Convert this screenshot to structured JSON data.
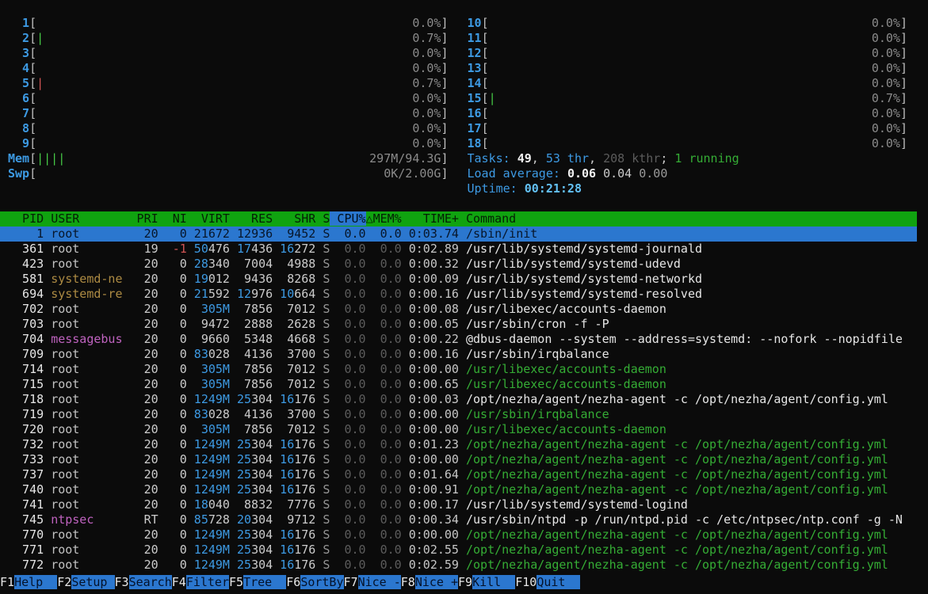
{
  "meters": {
    "left": [
      {
        "name": "cpu-meter-1",
        "label": "  1",
        "bars": 0,
        "bar_color": "green",
        "value": "0.0%"
      },
      {
        "name": "cpu-meter-2",
        "label": "  2",
        "bars": 1,
        "bar_color": "green",
        "value": "0.7%"
      },
      {
        "name": "cpu-meter-3",
        "label": "  3",
        "bars": 0,
        "bar_color": "green",
        "value": "0.0%"
      },
      {
        "name": "cpu-meter-4",
        "label": "  4",
        "bars": 0,
        "bar_color": "green",
        "value": "0.0%"
      },
      {
        "name": "cpu-meter-5",
        "label": "  5",
        "bars": 1,
        "bar_color": "red",
        "value": "0.7%"
      },
      {
        "name": "cpu-meter-6",
        "label": "  6",
        "bars": 0,
        "bar_color": "green",
        "value": "0.0%"
      },
      {
        "name": "cpu-meter-7",
        "label": "  7",
        "bars": 0,
        "bar_color": "green",
        "value": "0.0%"
      },
      {
        "name": "cpu-meter-8",
        "label": "  8",
        "bars": 0,
        "bar_color": "green",
        "value": "0.0%"
      },
      {
        "name": "cpu-meter-9",
        "label": "  9",
        "bars": 0,
        "bar_color": "green",
        "value": "0.0%"
      },
      {
        "name": "mem-meter",
        "label": "Mem",
        "bars": 4,
        "bar_color": "green",
        "value": "297M/94.3G"
      },
      {
        "name": "swp-meter",
        "label": "Swp",
        "bars": 0,
        "bar_color": "green",
        "value": "0K/2.00G"
      }
    ],
    "right": [
      {
        "name": "cpu-meter-10",
        "label": "10",
        "bars": 0,
        "bar_color": "green",
        "value": "0.0%"
      },
      {
        "name": "cpu-meter-11",
        "label": "11",
        "bars": 0,
        "bar_color": "green",
        "value": "0.0%"
      },
      {
        "name": "cpu-meter-12",
        "label": "12",
        "bars": 0,
        "bar_color": "green",
        "value": "0.0%"
      },
      {
        "name": "cpu-meter-13",
        "label": "13",
        "bars": 0,
        "bar_color": "green",
        "value": "0.0%"
      },
      {
        "name": "cpu-meter-14",
        "label": "14",
        "bars": 0,
        "bar_color": "green",
        "value": "0.0%"
      },
      {
        "name": "cpu-meter-15",
        "label": "15",
        "bars": 1,
        "bar_color": "green",
        "value": "0.7%"
      },
      {
        "name": "cpu-meter-16",
        "label": "16",
        "bars": 0,
        "bar_color": "green",
        "value": "0.0%"
      },
      {
        "name": "cpu-meter-17",
        "label": "17",
        "bars": 0,
        "bar_color": "green",
        "value": "0.0%"
      },
      {
        "name": "cpu-meter-18",
        "label": "18",
        "bars": 0,
        "bar_color": "green",
        "value": "0.0%"
      },
      {
        "name": "tasks-summary",
        "segments": [
          [
            "Tasks: ",
            "cyan"
          ],
          [
            "49",
            "bold"
          ],
          [
            ", ",
            "norm"
          ],
          [
            "53 thr",
            "cyan"
          ],
          [
            ", ",
            "norm"
          ],
          [
            "208 kthr",
            "shadow"
          ],
          [
            "; ",
            "norm"
          ],
          [
            "1 running",
            "green"
          ]
        ]
      },
      {
        "name": "load-average",
        "segments": [
          [
            "Load average: ",
            "cyan"
          ],
          [
            "0.06 ",
            "bold"
          ],
          [
            "0.04 ",
            "norm"
          ],
          [
            "0.00",
            "gray"
          ]
        ]
      },
      {
        "name": "uptime",
        "segments": [
          [
            "Uptime: ",
            "cyan"
          ],
          [
            "00:21:28",
            "bcyan"
          ]
        ]
      }
    ]
  },
  "table": {
    "headers": {
      "pid": "PID",
      "user": "USER",
      "pri": "PRI",
      "ni": "NI",
      "virt": "VIRT",
      "res": "RES",
      "shr": "SHR",
      "s": "S",
      "cpu": "CPU%",
      "mem": "MEM%",
      "time": "TIME+",
      "cmd": "Command"
    },
    "sort_column": "cpu",
    "sort_arrow": "△",
    "rows": [
      {
        "pid": "1",
        "user": "root",
        "pri": "20",
        "ni": "0",
        "virt": "21672",
        "res": "12936",
        "shr": "9452",
        "s": "S",
        "cpu": "0.0",
        "mem": "0.0",
        "time": "0:03.74",
        "cmd": "/sbin/init",
        "selected": true
      },
      {
        "pid": "361",
        "user": "root",
        "pri": "19",
        "ni": "-1",
        "virt": "50476",
        "res": "17436",
        "shr": "16272",
        "s": "S",
        "cpu": "0.0",
        "mem": "0.0",
        "time": "0:02.89",
        "cmd": "/usr/lib/systemd/systemd-journald"
      },
      {
        "pid": "423",
        "user": "root",
        "pri": "20",
        "ni": "0",
        "virt": "28340",
        "res": "7004",
        "shr": "4988",
        "s": "S",
        "cpu": "0.0",
        "mem": "0.0",
        "time": "0:00.32",
        "cmd": "/usr/lib/systemd/systemd-udevd"
      },
      {
        "pid": "581",
        "user": "systemd-ne",
        "user_color": "yellow",
        "pri": "20",
        "ni": "0",
        "virt": "19012",
        "res": "9436",
        "shr": "8268",
        "s": "S",
        "cpu": "0.0",
        "mem": "0.0",
        "time": "0:00.09",
        "cmd": "/usr/lib/systemd/systemd-networkd"
      },
      {
        "pid": "694",
        "user": "systemd-re",
        "user_color": "yellow",
        "pri": "20",
        "ni": "0",
        "virt": "21592",
        "res": "12976",
        "shr": "10664",
        "s": "S",
        "cpu": "0.0",
        "mem": "0.0",
        "time": "0:00.16",
        "cmd": "/usr/lib/systemd/systemd-resolved"
      },
      {
        "pid": "702",
        "user": "root",
        "pri": "20",
        "ni": "0",
        "virt": "305M",
        "res": "7856",
        "shr": "7012",
        "s": "S",
        "cpu": "0.0",
        "mem": "0.0",
        "time": "0:00.08",
        "cmd": "/usr/libexec/accounts-daemon"
      },
      {
        "pid": "703",
        "user": "root",
        "pri": "20",
        "ni": "0",
        "virt": "9472",
        "res": "2888",
        "shr": "2628",
        "s": "S",
        "cpu": "0.0",
        "mem": "0.0",
        "time": "0:00.05",
        "cmd": "/usr/sbin/cron -f -P"
      },
      {
        "pid": "704",
        "user": "messagebus",
        "user_color": "magenta",
        "pri": "20",
        "ni": "0",
        "virt": "9660",
        "res": "5348",
        "shr": "4668",
        "s": "S",
        "cpu": "0.0",
        "mem": "0.0",
        "time": "0:00.22",
        "cmd": "@dbus-daemon --system --address=systemd: --nofork --nopidfile"
      },
      {
        "pid": "709",
        "user": "root",
        "pri": "20",
        "ni": "0",
        "virt": "83028",
        "res": "4136",
        "shr": "3700",
        "s": "S",
        "cpu": "0.0",
        "mem": "0.0",
        "time": "0:00.16",
        "cmd": "/usr/sbin/irqbalance"
      },
      {
        "pid": "714",
        "user": "root",
        "pri": "20",
        "ni": "0",
        "virt": "305M",
        "res": "7856",
        "shr": "7012",
        "s": "S",
        "cpu": "0.0",
        "mem": "0.0",
        "time": "0:00.00",
        "cmd": "/usr/libexec/accounts-daemon",
        "thread": true
      },
      {
        "pid": "715",
        "user": "root",
        "pri": "20",
        "ni": "0",
        "virt": "305M",
        "res": "7856",
        "shr": "7012",
        "s": "S",
        "cpu": "0.0",
        "mem": "0.0",
        "time": "0:00.65",
        "cmd": "/usr/libexec/accounts-daemon",
        "thread": true
      },
      {
        "pid": "718",
        "user": "root",
        "pri": "20",
        "ni": "0",
        "virt": "1249M",
        "res": "25304",
        "shr": "16176",
        "s": "S",
        "cpu": "0.0",
        "mem": "0.0",
        "time": "0:00.03",
        "cmd": "/opt/nezha/agent/nezha-agent -c /opt/nezha/agent/config.yml"
      },
      {
        "pid": "719",
        "user": "root",
        "pri": "20",
        "ni": "0",
        "virt": "83028",
        "res": "4136",
        "shr": "3700",
        "s": "S",
        "cpu": "0.0",
        "mem": "0.0",
        "time": "0:00.00",
        "cmd": "/usr/sbin/irqbalance",
        "thread": true
      },
      {
        "pid": "720",
        "user": "root",
        "pri": "20",
        "ni": "0",
        "virt": "305M",
        "res": "7856",
        "shr": "7012",
        "s": "S",
        "cpu": "0.0",
        "mem": "0.0",
        "time": "0:00.00",
        "cmd": "/usr/libexec/accounts-daemon",
        "thread": true
      },
      {
        "pid": "732",
        "user": "root",
        "pri": "20",
        "ni": "0",
        "virt": "1249M",
        "res": "25304",
        "shr": "16176",
        "s": "S",
        "cpu": "0.0",
        "mem": "0.0",
        "time": "0:01.23",
        "cmd": "/opt/nezha/agent/nezha-agent -c /opt/nezha/agent/config.yml",
        "thread": true
      },
      {
        "pid": "733",
        "user": "root",
        "pri": "20",
        "ni": "0",
        "virt": "1249M",
        "res": "25304",
        "shr": "16176",
        "s": "S",
        "cpu": "0.0",
        "mem": "0.0",
        "time": "0:00.00",
        "cmd": "/opt/nezha/agent/nezha-agent -c /opt/nezha/agent/config.yml",
        "thread": true
      },
      {
        "pid": "737",
        "user": "root",
        "pri": "20",
        "ni": "0",
        "virt": "1249M",
        "res": "25304",
        "shr": "16176",
        "s": "S",
        "cpu": "0.0",
        "mem": "0.0",
        "time": "0:01.64",
        "cmd": "/opt/nezha/agent/nezha-agent -c /opt/nezha/agent/config.yml",
        "thread": true
      },
      {
        "pid": "740",
        "user": "root",
        "pri": "20",
        "ni": "0",
        "virt": "1249M",
        "res": "25304",
        "shr": "16176",
        "s": "S",
        "cpu": "0.0",
        "mem": "0.0",
        "time": "0:00.91",
        "cmd": "/opt/nezha/agent/nezha-agent -c /opt/nezha/agent/config.yml",
        "thread": true
      },
      {
        "pid": "741",
        "user": "root",
        "pri": "20",
        "ni": "0",
        "virt": "18040",
        "res": "8832",
        "shr": "7776",
        "s": "S",
        "cpu": "0.0",
        "mem": "0.0",
        "time": "0:00.17",
        "cmd": "/usr/lib/systemd/systemd-logind"
      },
      {
        "pid": "745",
        "user": "ntpsec",
        "user_color": "magenta",
        "pri": "RT",
        "ni": "0",
        "virt": "85728",
        "res": "20304",
        "shr": "9712",
        "s": "S",
        "cpu": "0.0",
        "mem": "0.0",
        "time": "0:00.34",
        "cmd": "/usr/sbin/ntpd -p /run/ntpd.pid -c /etc/ntpsec/ntp.conf -g -N"
      },
      {
        "pid": "770",
        "user": "root",
        "pri": "20",
        "ni": "0",
        "virt": "1249M",
        "res": "25304",
        "shr": "16176",
        "s": "S",
        "cpu": "0.0",
        "mem": "0.0",
        "time": "0:00.00",
        "cmd": "/opt/nezha/agent/nezha-agent -c /opt/nezha/agent/config.yml",
        "thread": true
      },
      {
        "pid": "771",
        "user": "root",
        "pri": "20",
        "ni": "0",
        "virt": "1249M",
        "res": "25304",
        "shr": "16176",
        "s": "S",
        "cpu": "0.0",
        "mem": "0.0",
        "time": "0:02.55",
        "cmd": "/opt/nezha/agent/nezha-agent -c /opt/nezha/agent/config.yml",
        "thread": true
      },
      {
        "pid": "772",
        "user": "root",
        "pri": "20",
        "ni": "0",
        "virt": "1249M",
        "res": "25304",
        "shr": "16176",
        "s": "S",
        "cpu": "0.0",
        "mem": "0.0",
        "time": "0:02.59",
        "cmd": "/opt/nezha/agent/nezha-agent -c /opt/nezha/agent/config.yml",
        "thread": true
      }
    ]
  },
  "fkeys": [
    {
      "key": "F1",
      "label": "Help  "
    },
    {
      "key": "F2",
      "label": "Setup "
    },
    {
      "key": "F3",
      "label": "Search"
    },
    {
      "key": "F4",
      "label": "Filter"
    },
    {
      "key": "F5",
      "label": "Tree  "
    },
    {
      "key": "F6",
      "label": "SortBy"
    },
    {
      "key": "F7",
      "label": "Nice -"
    },
    {
      "key": "F8",
      "label": "Nice +"
    },
    {
      "key": "F9",
      "label": "Kill  "
    },
    {
      "key": "F10",
      "label": "Quit  "
    }
  ]
}
